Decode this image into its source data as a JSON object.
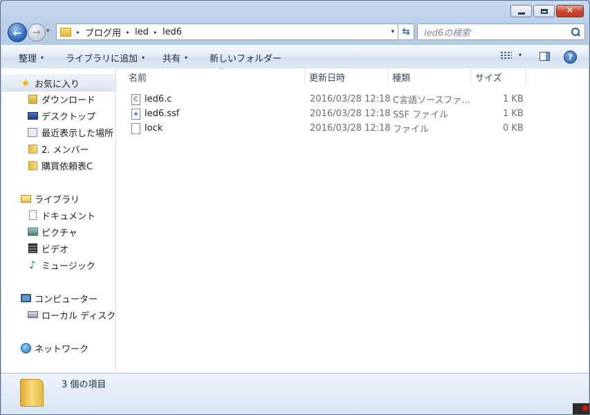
{
  "window": {
    "caption": {
      "minimize": "",
      "maximize": "",
      "close": "✕"
    }
  },
  "nav": {
    "back_glyph": "←",
    "forward_glyph": "→",
    "history_caret": "▾",
    "breadcrumb": [
      "ブログ用",
      "led",
      "led6"
    ],
    "crumb_separator": "▸",
    "address_dropdown": "▾",
    "refresh_glyph": "⇆",
    "search_placeholder": "led6の検索"
  },
  "toolbar": {
    "organize": "整理",
    "include_in_library": "ライブラリに追加",
    "share": "共有",
    "new_folder": "新しいフォルダー",
    "caret": "▾",
    "help": "?"
  },
  "navpane": {
    "favorites": {
      "label": "お気に入り",
      "icon": "star-icon",
      "items": [
        {
          "label": "ダウンロード",
          "icon": "downloads-folder-icon"
        },
        {
          "label": "デスクトップ",
          "icon": "desktop-icon"
        },
        {
          "label": "最近表示した場所",
          "icon": "recent-places-icon"
        },
        {
          "label": "2. メンバー",
          "icon": "folder-icon"
        },
        {
          "label": "購買依頼表C",
          "icon": "folder-icon"
        }
      ]
    },
    "libraries": {
      "label": "ライブラリ",
      "icon": "library-icon",
      "items": [
        {
          "label": "ドキュメント",
          "icon": "documents-icon"
        },
        {
          "label": "ピクチャ",
          "icon": "pictures-icon"
        },
        {
          "label": "ビデオ",
          "icon": "videos-icon"
        },
        {
          "label": "ミュージック",
          "icon": "music-icon"
        }
      ]
    },
    "computer": {
      "label": "コンピューター",
      "icon": "computer-icon",
      "items": [
        {
          "label": "ローカル ディスク (",
          "icon": "local-disk-icon"
        }
      ]
    },
    "network": {
      "label": "ネットワーク",
      "icon": "network-icon"
    }
  },
  "filelist": {
    "columns": {
      "name": "名前",
      "date": "更新日時",
      "type": "種類",
      "size": "サイズ",
      "sort_indicator": "^"
    },
    "files": [
      {
        "name": "led6.c",
        "date": "2016/03/28 12:18",
        "type": "C言語ソースファ...",
        "size": "1 KB",
        "icon_glyph": "C",
        "icon": "c-source-file-icon"
      },
      {
        "name": "led6.ssf",
        "date": "2016/03/28 12:18",
        "type": "SSF ファイル",
        "size": "1 KB",
        "icon_glyph": "◈",
        "icon": "ssf-file-icon"
      },
      {
        "name": "lock",
        "date": "2016/03/28 12:18",
        "type": "ファイル",
        "size": "0 KB",
        "icon_glyph": "",
        "icon": "generic-file-icon"
      }
    ]
  },
  "details": {
    "item_count": "3 個の項目",
    "icon": "folder-large-icon"
  }
}
